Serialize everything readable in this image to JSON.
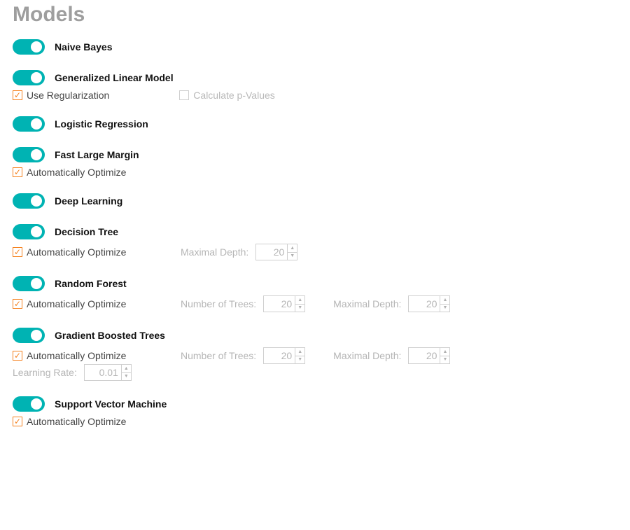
{
  "title": "Models",
  "models": {
    "naive_bayes": {
      "label": "Naive Bayes"
    },
    "glm": {
      "label": "Generalized Linear Model",
      "use_regularization": {
        "label": "Use Regularization",
        "checked": true
      },
      "calc_pvalues": {
        "label": "Calculate p-Values",
        "checked": false,
        "disabled": true
      }
    },
    "logistic": {
      "label": "Logistic Regression"
    },
    "flm": {
      "label": "Fast Large Margin",
      "auto_opt": {
        "label": "Automatically Optimize",
        "checked": true
      }
    },
    "deep": {
      "label": "Deep Learning"
    },
    "dtree": {
      "label": "Decision Tree",
      "auto_opt": {
        "label": "Automatically Optimize",
        "checked": true
      },
      "max_depth": {
        "label": "Maximal Depth:",
        "value": "20"
      }
    },
    "rforest": {
      "label": "Random Forest",
      "auto_opt": {
        "label": "Automatically Optimize",
        "checked": true
      },
      "n_trees": {
        "label": "Number of Trees:",
        "value": "20"
      },
      "max_depth": {
        "label": "Maximal Depth:",
        "value": "20"
      }
    },
    "gbt": {
      "label": "Gradient Boosted Trees",
      "auto_opt": {
        "label": "Automatically Optimize",
        "checked": true
      },
      "n_trees": {
        "label": "Number of Trees:",
        "value": "20"
      },
      "max_depth": {
        "label": "Maximal Depth:",
        "value": "20"
      },
      "lr": {
        "label": "Learning Rate:",
        "value": "0.01"
      }
    },
    "svm": {
      "label": "Support Vector Machine",
      "auto_opt": {
        "label": "Automatically Optimize",
        "checked": true
      }
    }
  }
}
